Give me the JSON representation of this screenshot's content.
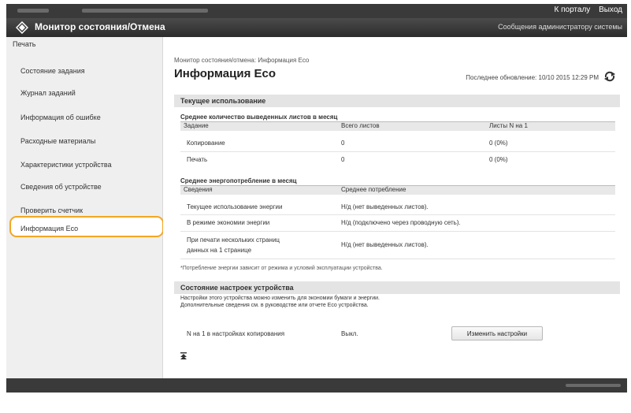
{
  "header": {
    "portal_link": "К порталу",
    "logout_link": "Выход",
    "app_title": "Монитор состояния/Отмена",
    "admin_message": "Сообщения администратору системы"
  },
  "sidebar": {
    "section": "Печать",
    "items": [
      {
        "label": "Состояние задания"
      },
      {
        "label": "Журнал заданий"
      },
      {
        "label": "Информация об ошибке"
      },
      {
        "label": "Расходные материалы"
      },
      {
        "label": "Характеристики устройства"
      },
      {
        "label": "Сведения об устройстве"
      },
      {
        "label": "Проверить счетчик"
      },
      {
        "label": "Информация Eco"
      }
    ],
    "selected_index": 7
  },
  "main": {
    "breadcrumb": "Монитор состояния/отмена: Информация Eco",
    "title": "Информация Eco",
    "last_update": "Последнее обновление: 10/10 2015 12:29 PM",
    "current_usage": {
      "heading": "Текущее использование",
      "avg_sheets": {
        "title": "Среднее количество выведенных листов в месяц",
        "columns": [
          "Задание",
          "Всего листов",
          "Листы N на 1"
        ],
        "rows": [
          [
            "Копирование",
            "0",
            "0 (0%)"
          ],
          [
            "Печать",
            "0",
            "0 (0%)"
          ]
        ]
      },
      "avg_power": {
        "title": "Среднее энергопотребление в месяц",
        "columns": [
          "Сведения",
          "Среднее потребление"
        ],
        "rows": [
          [
            "Текущее использование энергии",
            "Н/д (нет выведенных листов)."
          ],
          [
            "В режиме экономии энергии",
            "Н/д (подключено через проводную сеть)."
          ],
          [
            "При печати нескольких страниц",
            "Н/д (нет выведенных листов)."
          ]
        ],
        "row3_label_line2": "данных на 1 странице"
      },
      "note": "*Потребление энергии зависит от режима и условий эксплуатации устройства."
    },
    "settings": {
      "heading": "Состояние настроек устройства",
      "desc_line1": "Настройки этого устройства можно изменить для экономии бумаги и энергии.",
      "desc_line2": "Дополнительные сведения см. в руководстве или отчете Eco устройства.",
      "row_label": "N на 1 в настройках копирования",
      "row_value": "Выкл.",
      "change_button": "Изменить настройки"
    }
  },
  "colors": {
    "dark_bar": "#3a3a3a",
    "highlight": "#f5a623",
    "refresh_icon": "#333333"
  }
}
